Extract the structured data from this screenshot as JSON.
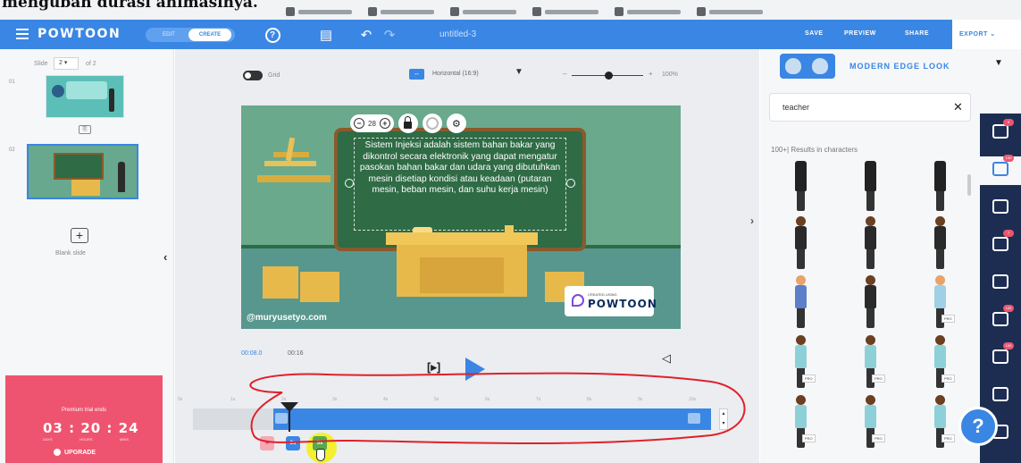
{
  "caption": "mengubah durasi animasinya.",
  "app": {
    "logo": "POWTOON",
    "mode_edit": "EDIT",
    "mode_create": "CREATE",
    "doc_title": "untitled-3",
    "save": "SAVE",
    "preview": "PREVIEW",
    "share": "SHARE",
    "export": "EXPORT ⌄"
  },
  "left": {
    "slide_label": "Slide",
    "slide_value": "2 ▾",
    "slide_of": "of 2",
    "slide1_num": "01",
    "slide2_num": "02",
    "blank_slide": "Blank slide",
    "trial_title": "Premium trial ends",
    "trial_time": "03 : 20 : 24",
    "trial_units": [
      "DAYS",
      "HOURS",
      "MINS"
    ],
    "upgrade": "UPGRADE"
  },
  "canvas": {
    "grid": "Grid",
    "ratio": "Horizontal (16:9)",
    "zoom": "100%",
    "font_size": "28",
    "board_text": "Sistem Injeksi adalah sistem bahan bakar yang dikontrol secara elektronik yang dapat mengatur pasokan bahan bakar dan udara yang dibutuhkan mesin disetiap kondisi atau keadaan (putaran mesin, beban mesin, dan suhu kerja mesin)",
    "watermark": "@muryusetyo.com",
    "badge_small": "CREATED USING",
    "badge_large": "POWTOON"
  },
  "timeline": {
    "current": "00:08.0",
    "total": "00:16",
    "ticks": [
      "0s",
      "1s",
      "2s",
      "3s",
      "4s",
      "5s",
      "6s",
      "7s",
      "8s",
      "9s",
      "10s"
    ],
    "lane_labels": [
      "3s",
      "5s"
    ]
  },
  "right": {
    "look_title": "MODERN EDGE LOOK",
    "search_value": "teacher",
    "results": "100+| Results in characters",
    "pro_label": "PRO",
    "rail_badges": [
      "9",
      "100",
      "7",
      "100",
      "100"
    ],
    "help": "?"
  },
  "colors": {
    "brand_blue": "#3a86e4",
    "trial_pink": "#ee5470",
    "rail_navy": "#1d2d52",
    "chalkboard": "#2f6b45",
    "annotation_red": "#e0202a",
    "cursor_highlight": "#f4f01a"
  }
}
